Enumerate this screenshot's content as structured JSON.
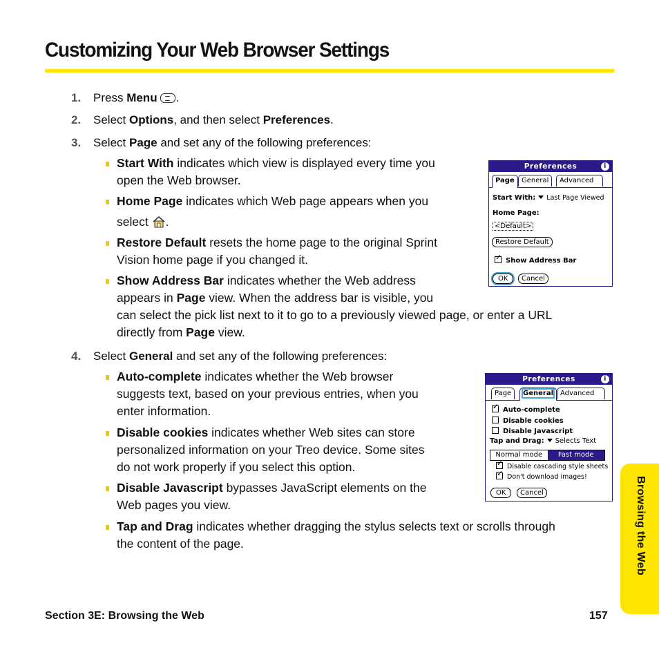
{
  "page_title": "Customizing Your Web Browser Settings",
  "accent_color": "#ffe600",
  "steps": [
    {
      "num": "1.",
      "pre": "Press ",
      "b1": "Menu",
      "post": ".",
      "icon": "menu-key-icon"
    },
    {
      "num": "2.",
      "pre": "Select ",
      "b1": "Options",
      "mid": ", and then select ",
      "b2": "Preferences",
      "post": "."
    },
    {
      "num": "3.",
      "pre": "Select ",
      "b1": "Page",
      "post": " and set any of the following preferences:"
    },
    {
      "num": "4.",
      "pre": "Select ",
      "b1": "General",
      "post": " and set any of the following preferences:"
    }
  ],
  "page_bullets": [
    {
      "term": "Start With",
      "l1": " indicates which view is displayed every time you",
      "l2": "open the Web browser."
    },
    {
      "term": "Home Page",
      "l1": " indicates which Web page appears when you",
      "l2a": "select ",
      "l2b": ".",
      "icon": "home-icon"
    },
    {
      "term": "Restore Default",
      "l1": " resets the home page to the original Sprint",
      "l2": "Vision home page if you changed it."
    },
    {
      "term": "Show Address Bar",
      "l1": " indicates whether the Web address",
      "l2a": "appears in ",
      "l2b": "Page",
      "l2c": " view. When the address bar is visible, you",
      "l3": "can select the pick list next to it to go to a previously viewed page, or enter a URL",
      "l4a": "directly from ",
      "l4b": "Page",
      "l4c": " view."
    }
  ],
  "general_bullets": [
    {
      "term": "Auto-complete",
      "l1": " indicates whether the Web browser",
      "l2": "suggests text, based on your previous entries, when you",
      "l3": "enter information."
    },
    {
      "term": "Disable cookies",
      "l1": " indicates whether Web sites can store",
      "l2": "personalized information on your Treo device. Some sites",
      "l3": "do not work properly if you select this option."
    },
    {
      "term": "Disable Javascript",
      "l1": " bypasses JavaScript elements on the",
      "l2": "Web pages you view."
    },
    {
      "term": "Tap and Drag",
      "l1": " indicates whether dragging the stylus selects text or scrolls through",
      "l2": "the content of the page."
    }
  ],
  "screen_page": {
    "title": "Preferences",
    "tabs": [
      "Page",
      "General",
      "Advanced"
    ],
    "active_tab": "Page",
    "start_with_label": "Start With:",
    "start_with_value": "Last Page Viewed",
    "home_page_label": "Home Page:",
    "home_page_value": "<Default>",
    "restore_button": "Restore Default",
    "show_address_bar": {
      "label": "Show Address Bar",
      "checked": true
    },
    "ok": "OK",
    "cancel": "Cancel"
  },
  "screen_general": {
    "title": "Preferences",
    "tabs": [
      "Page",
      "General",
      "Advanced"
    ],
    "active_tab": "General",
    "checkboxes": [
      {
        "label": "Auto-complete",
        "checked": true
      },
      {
        "label": "Disable cookies",
        "checked": false
      },
      {
        "label": "Disable Javascript",
        "checked": false
      }
    ],
    "tap_drag_label": "Tap and Drag:",
    "tap_drag_value": "Selects Text",
    "modes": [
      "Normal mode",
      "Fast mode"
    ],
    "selected_mode": "Fast mode",
    "sub_checkboxes": [
      {
        "label": "Disable cascading style sheets",
        "checked": true
      },
      {
        "label": "Don't download images!",
        "checked": true
      }
    ],
    "ok": "OK",
    "cancel": "Cancel"
  },
  "side_tab": "Browsing the Web",
  "footer": {
    "section": "Section 3E: Browsing the Web",
    "page_number": "157"
  }
}
